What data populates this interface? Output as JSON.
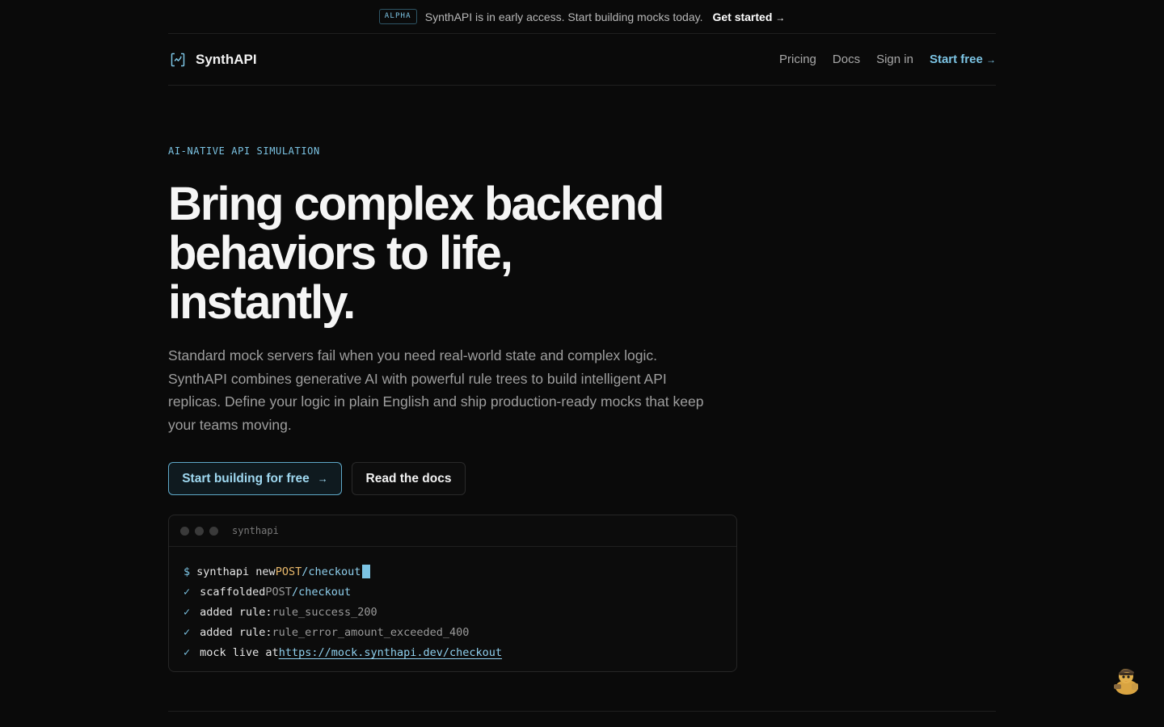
{
  "announcement": {
    "badge": "ALPHA",
    "text": "SynthAPI is in early access. Start building mocks today.",
    "cta": "Get started",
    "cta_arrow": "→"
  },
  "nav": {
    "brand": "SynthAPI",
    "links": [
      "Pricing",
      "Docs",
      "Sign in"
    ],
    "cta": "Start free",
    "cta_arrow": "→"
  },
  "hero": {
    "eyebrow": "AI-NATIVE API SIMULATION",
    "headline": "Bring complex backend behaviors to life, instantly.",
    "subtext": "Standard mock servers fail when you need real-world state and complex logic. SynthAPI combines generative AI with powerful rule trees to build intelligent API replicas. Define your logic in plain English and ship production-ready mocks that keep your teams moving.",
    "primary_button": "Start building for free",
    "primary_arrow": "→",
    "secondary_button": "Read the docs"
  },
  "terminal": {
    "title": "synthapi",
    "prompt": "$",
    "command": "synthapi new",
    "command_method": "POST",
    "command_path": "/checkout",
    "check_mark": "✓",
    "lines": [
      {
        "label": "scaffolded",
        "method": "POST",
        "path": "/checkout"
      },
      {
        "label": "added rule:",
        "value": "rule_success_200"
      },
      {
        "label": "added rule:",
        "value": "rule_error_amount_exceeded_400"
      },
      {
        "label": "mock live at",
        "url": "https://mock.synthapi.dev/checkout"
      }
    ]
  },
  "colors": {
    "accent": "#7cc4e4",
    "background": "#0a0a0a",
    "method": "#e8b86b"
  },
  "icons": {
    "brand": "bracket-sparkle-icon",
    "mascot": "duck-mascot-icon"
  }
}
